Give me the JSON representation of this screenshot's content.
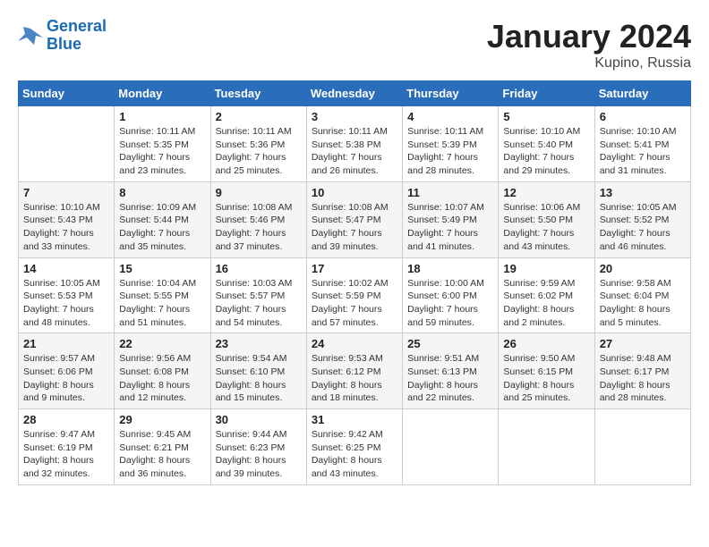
{
  "logo": {
    "line1": "General",
    "line2": "Blue"
  },
  "title": "January 2024",
  "location": "Kupino, Russia",
  "days_header": [
    "Sunday",
    "Monday",
    "Tuesday",
    "Wednesday",
    "Thursday",
    "Friday",
    "Saturday"
  ],
  "weeks": [
    [
      {
        "num": "",
        "info": ""
      },
      {
        "num": "1",
        "info": "Sunrise: 10:11 AM\nSunset: 5:35 PM\nDaylight: 7 hours\nand 23 minutes."
      },
      {
        "num": "2",
        "info": "Sunrise: 10:11 AM\nSunset: 5:36 PM\nDaylight: 7 hours\nand 25 minutes."
      },
      {
        "num": "3",
        "info": "Sunrise: 10:11 AM\nSunset: 5:38 PM\nDaylight: 7 hours\nand 26 minutes."
      },
      {
        "num": "4",
        "info": "Sunrise: 10:11 AM\nSunset: 5:39 PM\nDaylight: 7 hours\nand 28 minutes."
      },
      {
        "num": "5",
        "info": "Sunrise: 10:10 AM\nSunset: 5:40 PM\nDaylight: 7 hours\nand 29 minutes."
      },
      {
        "num": "6",
        "info": "Sunrise: 10:10 AM\nSunset: 5:41 PM\nDaylight: 7 hours\nand 31 minutes."
      }
    ],
    [
      {
        "num": "7",
        "info": "Sunrise: 10:10 AM\nSunset: 5:43 PM\nDaylight: 7 hours\nand 33 minutes."
      },
      {
        "num": "8",
        "info": "Sunrise: 10:09 AM\nSunset: 5:44 PM\nDaylight: 7 hours\nand 35 minutes."
      },
      {
        "num": "9",
        "info": "Sunrise: 10:08 AM\nSunset: 5:46 PM\nDaylight: 7 hours\nand 37 minutes."
      },
      {
        "num": "10",
        "info": "Sunrise: 10:08 AM\nSunset: 5:47 PM\nDaylight: 7 hours\nand 39 minutes."
      },
      {
        "num": "11",
        "info": "Sunrise: 10:07 AM\nSunset: 5:49 PM\nDaylight: 7 hours\nand 41 minutes."
      },
      {
        "num": "12",
        "info": "Sunrise: 10:06 AM\nSunset: 5:50 PM\nDaylight: 7 hours\nand 43 minutes."
      },
      {
        "num": "13",
        "info": "Sunrise: 10:05 AM\nSunset: 5:52 PM\nDaylight: 7 hours\nand 46 minutes."
      }
    ],
    [
      {
        "num": "14",
        "info": "Sunrise: 10:05 AM\nSunset: 5:53 PM\nDaylight: 7 hours\nand 48 minutes."
      },
      {
        "num": "15",
        "info": "Sunrise: 10:04 AM\nSunset: 5:55 PM\nDaylight: 7 hours\nand 51 minutes."
      },
      {
        "num": "16",
        "info": "Sunrise: 10:03 AM\nSunset: 5:57 PM\nDaylight: 7 hours\nand 54 minutes."
      },
      {
        "num": "17",
        "info": "Sunrise: 10:02 AM\nSunset: 5:59 PM\nDaylight: 7 hours\nand 57 minutes."
      },
      {
        "num": "18",
        "info": "Sunrise: 10:00 AM\nSunset: 6:00 PM\nDaylight: 7 hours\nand 59 minutes."
      },
      {
        "num": "19",
        "info": "Sunrise: 9:59 AM\nSunset: 6:02 PM\nDaylight: 8 hours\nand 2 minutes."
      },
      {
        "num": "20",
        "info": "Sunrise: 9:58 AM\nSunset: 6:04 PM\nDaylight: 8 hours\nand 5 minutes."
      }
    ],
    [
      {
        "num": "21",
        "info": "Sunrise: 9:57 AM\nSunset: 6:06 PM\nDaylight: 8 hours\nand 9 minutes."
      },
      {
        "num": "22",
        "info": "Sunrise: 9:56 AM\nSunset: 6:08 PM\nDaylight: 8 hours\nand 12 minutes."
      },
      {
        "num": "23",
        "info": "Sunrise: 9:54 AM\nSunset: 6:10 PM\nDaylight: 8 hours\nand 15 minutes."
      },
      {
        "num": "24",
        "info": "Sunrise: 9:53 AM\nSunset: 6:12 PM\nDaylight: 8 hours\nand 18 minutes."
      },
      {
        "num": "25",
        "info": "Sunrise: 9:51 AM\nSunset: 6:13 PM\nDaylight: 8 hours\nand 22 minutes."
      },
      {
        "num": "26",
        "info": "Sunrise: 9:50 AM\nSunset: 6:15 PM\nDaylight: 8 hours\nand 25 minutes."
      },
      {
        "num": "27",
        "info": "Sunrise: 9:48 AM\nSunset: 6:17 PM\nDaylight: 8 hours\nand 28 minutes."
      }
    ],
    [
      {
        "num": "28",
        "info": "Sunrise: 9:47 AM\nSunset: 6:19 PM\nDaylight: 8 hours\nand 32 minutes."
      },
      {
        "num": "29",
        "info": "Sunrise: 9:45 AM\nSunset: 6:21 PM\nDaylight: 8 hours\nand 36 minutes."
      },
      {
        "num": "30",
        "info": "Sunrise: 9:44 AM\nSunset: 6:23 PM\nDaylight: 8 hours\nand 39 minutes."
      },
      {
        "num": "31",
        "info": "Sunrise: 9:42 AM\nSunset: 6:25 PM\nDaylight: 8 hours\nand 43 minutes."
      },
      {
        "num": "",
        "info": ""
      },
      {
        "num": "",
        "info": ""
      },
      {
        "num": "",
        "info": ""
      }
    ]
  ]
}
